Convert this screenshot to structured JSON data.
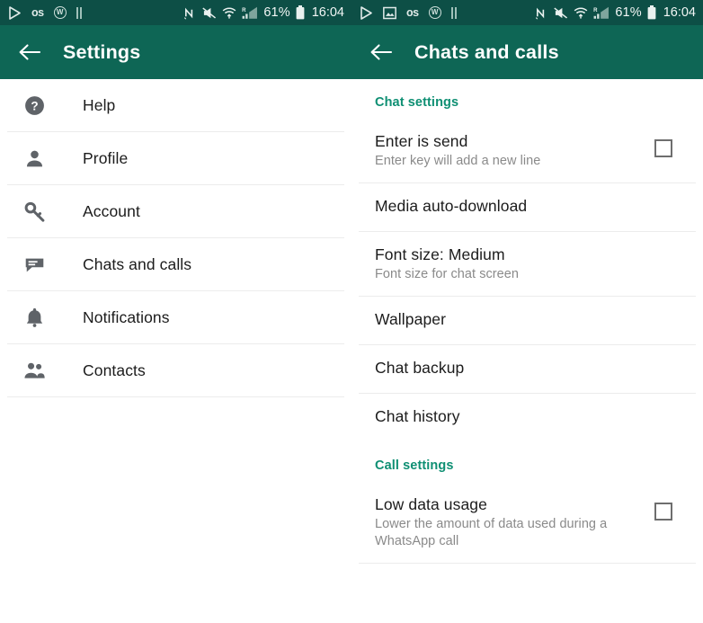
{
  "statusbar": {
    "left_icons_a": [
      "play-icon",
      "lastfm-os-icon",
      "circled-w-icon",
      "pause-bars-icon"
    ],
    "left_icons_b": [
      "play-icon",
      "image-icon",
      "lastfm-os-icon",
      "circled-w-icon",
      "pause-bars-icon"
    ],
    "os_glyph": "ᴏs",
    "w_glyph": "W",
    "right_icons": [
      "nfc-n-icon",
      "mute-icon",
      "wifi-icon",
      "roaming-signal-icon",
      "battery-icon"
    ],
    "roaming_letter": "R",
    "battery_percent": "61%",
    "time": "16:04"
  },
  "left_screen": {
    "appbar": {
      "title": "Settings",
      "back_icon": "arrow-left-icon"
    },
    "items": [
      {
        "label": "Help",
        "icon": "help-circle-icon"
      },
      {
        "label": "Profile",
        "icon": "person-icon"
      },
      {
        "label": "Account",
        "icon": "key-icon"
      },
      {
        "label": "Chats and calls",
        "icon": "chat-bubble-icon"
      },
      {
        "label": "Notifications",
        "icon": "bell-icon"
      },
      {
        "label": "Contacts",
        "icon": "people-icon"
      }
    ]
  },
  "right_screen": {
    "appbar": {
      "title": "Chats and calls",
      "back_icon": "arrow-left-icon"
    },
    "sections": [
      {
        "heading": "Chat settings",
        "rows": [
          {
            "title": "Enter is send",
            "subtitle": "Enter key will add a new line",
            "has_checkbox": true,
            "checked": false
          },
          {
            "title": "Media auto-download",
            "subtitle": "",
            "has_checkbox": false,
            "checked": false
          },
          {
            "title": "Font size: Medium",
            "subtitle": "Font size for chat screen",
            "has_checkbox": false,
            "checked": false
          },
          {
            "title": "Wallpaper",
            "subtitle": "",
            "has_checkbox": false,
            "checked": false
          },
          {
            "title": "Chat backup",
            "subtitle": "",
            "has_checkbox": false,
            "checked": false
          },
          {
            "title": "Chat history",
            "subtitle": "",
            "has_checkbox": false,
            "checked": false
          }
        ]
      },
      {
        "heading": "Call settings",
        "rows": [
          {
            "title": "Low data usage",
            "subtitle": "Lower the amount of data used during a WhatsApp call",
            "has_checkbox": true,
            "checked": false
          }
        ]
      }
    ]
  },
  "colors": {
    "statusbar_bg": "#0d4f46",
    "appbar_bg": "#0e6655",
    "section_heading": "#0e8f73",
    "icon_grey": "#5f6368",
    "divider": "#ececec",
    "title_text": "#1c1c1c",
    "subtitle_text": "#8a8a8a"
  }
}
